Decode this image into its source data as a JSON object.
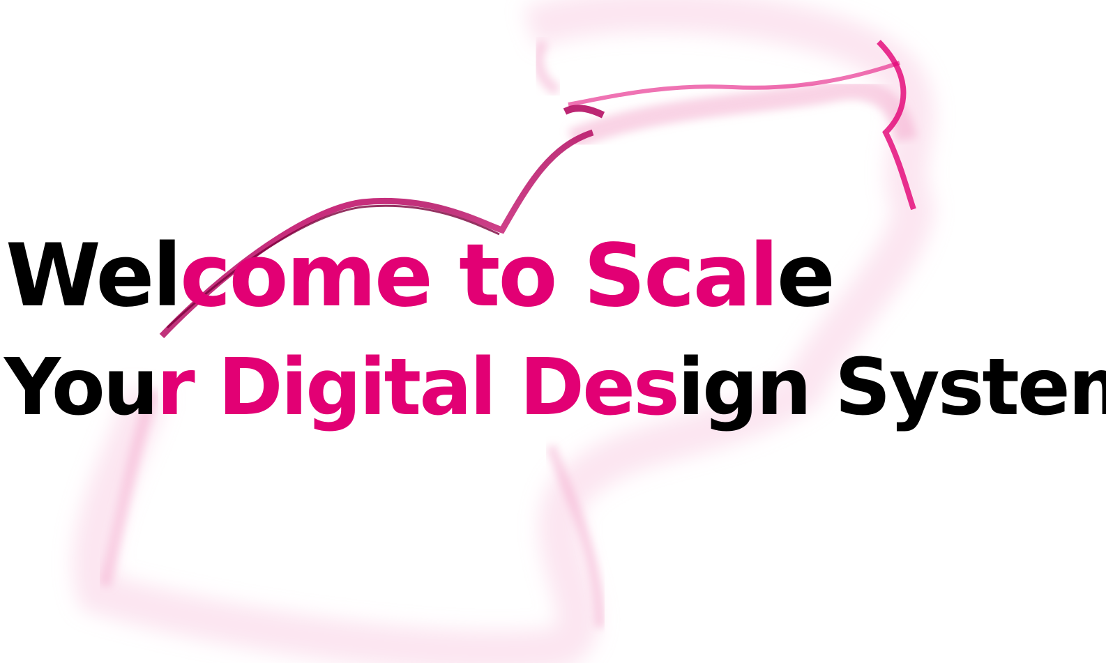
{
  "hero": {
    "title_line1": "Welcome to Scale",
    "title_line2": "Your Digital Design System"
  },
  "colors": {
    "brand_magenta": "#e20074",
    "text": "#000000",
    "background": "#ffffff"
  }
}
